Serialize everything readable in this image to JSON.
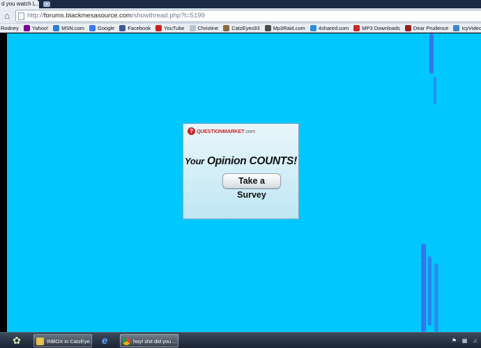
{
  "tab": {
    "title": "d you watch L...",
    "new_tab_label": "+"
  },
  "address_bar": {
    "scheme": "http://",
    "host": "forums.blackmesasource.com",
    "path": "/showthread.php?t=5199"
  },
  "bookmarks": [
    {
      "label": "Rodney",
      "icon": "none",
      "color": ""
    },
    {
      "label": "Yahoo!",
      "icon": "yahoo-icon",
      "color": "#7b0099"
    },
    {
      "label": "MSN.com",
      "icon": "msn-icon",
      "color": "#2a7fd4"
    },
    {
      "label": "Google",
      "icon": "google-icon",
      "color": "#3b7be8"
    },
    {
      "label": "Facebook",
      "icon": "facebook-icon",
      "color": "#3b5998"
    },
    {
      "label": "YouTube",
      "icon": "youtube-icon",
      "color": "#cc1f1f"
    },
    {
      "label": "Christine",
      "icon": "page-icon",
      "color": "#b9c3cf"
    },
    {
      "label": "CatzEyes93",
      "icon": "cat-icon",
      "color": "#8a6c3c"
    },
    {
      "label": "Mp3Raid.com",
      "icon": "mp3raid-icon",
      "color": "#4a4a4a"
    },
    {
      "label": "4shared.com",
      "icon": "4shared-icon",
      "color": "#2c8dd8"
    },
    {
      "label": "MP3 Downloads",
      "icon": "mp3-downloads-icon",
      "color": "#c42a2a"
    },
    {
      "label": "Dear Prudence",
      "icon": "dear-prudence-icon",
      "color": "#9a1f1f"
    },
    {
      "label": "IcyVideo",
      "icon": "icyvideo-icon",
      "color": "#3a86c8"
    }
  ],
  "page": {
    "background": "#00c8ff",
    "streak_color": "#3a6cf0"
  },
  "ad": {
    "brand": "QUESTIONMARKET",
    "brand_suffix": ".com",
    "brand_color": "#c1272d",
    "headline_part1": "Your",
    "headline_part2": "Opinion COUNTS!",
    "button_label": "Take a Survey"
  },
  "taskbar": {
    "tasks": [
      {
        "label": "INBOX in CatzEye...",
        "icon": "mail-icon"
      },
      {
        "label": "",
        "icon": "internet-explorer-icon"
      },
      {
        "label": "hoy! shit did you ...",
        "icon": "chrome-icon"
      }
    ],
    "tray_icons": [
      "flag-icon",
      "network-icon",
      "volume-icon"
    ]
  }
}
